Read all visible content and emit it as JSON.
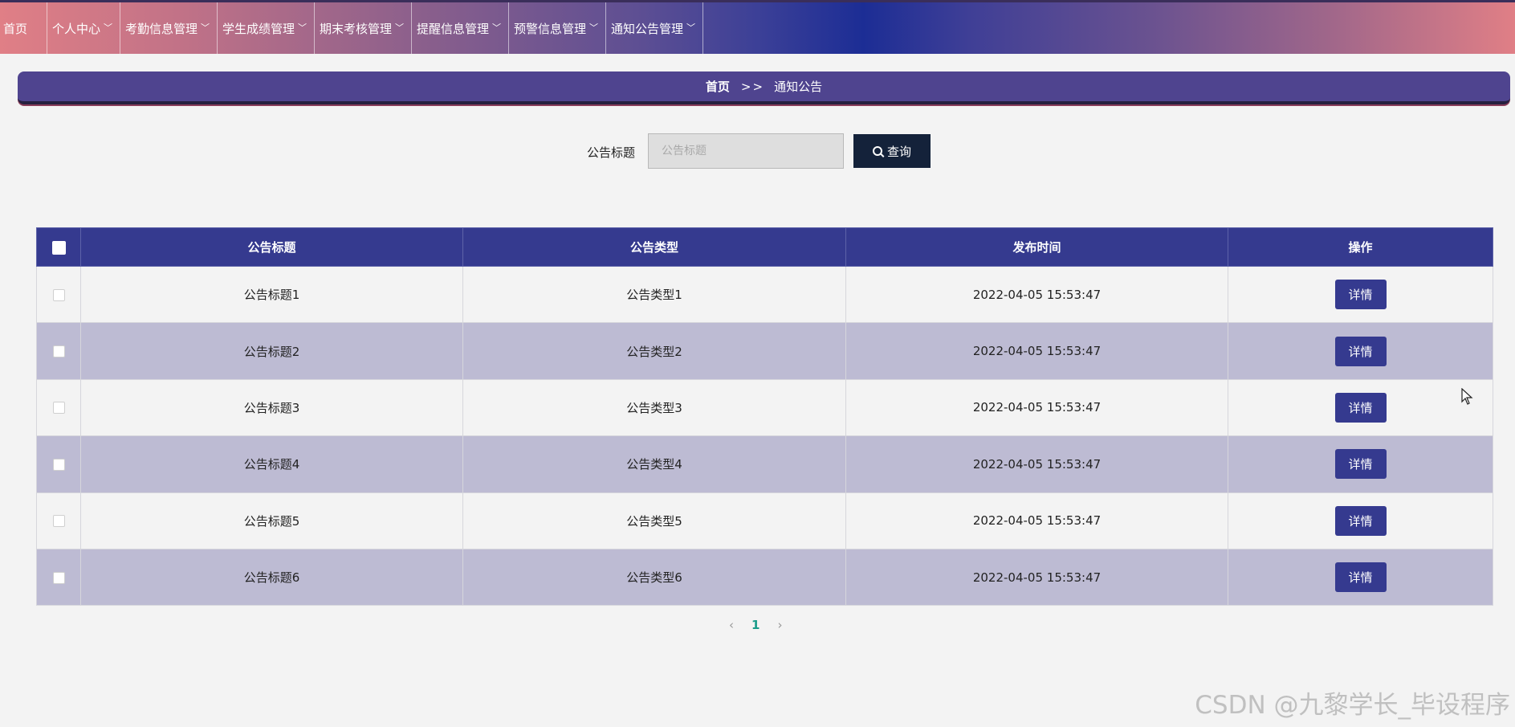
{
  "nav": {
    "home": "首页",
    "items": [
      {
        "label": "个人中心"
      },
      {
        "label": "考勤信息管理"
      },
      {
        "label": "学生成绩管理"
      },
      {
        "label": "期末考核管理"
      },
      {
        "label": "提醒信息管理"
      },
      {
        "label": "预警信息管理"
      },
      {
        "label": "通知公告管理"
      }
    ]
  },
  "breadcrumb": {
    "home": "首页",
    "separator": ">>",
    "current": "通知公告"
  },
  "search": {
    "label": "公告标题",
    "placeholder": "公告标题",
    "value": "",
    "button_label": "查询"
  },
  "table": {
    "columns": [
      "公告标题",
      "公告类型",
      "发布时间",
      "操作"
    ],
    "rows": [
      {
        "title": "公告标题1",
        "type": "公告类型1",
        "time": "2022-04-05 15:53:47",
        "action": "详情"
      },
      {
        "title": "公告标题2",
        "type": "公告类型2",
        "time": "2022-04-05 15:53:47",
        "action": "详情"
      },
      {
        "title": "公告标题3",
        "type": "公告类型3",
        "time": "2022-04-05 15:53:47",
        "action": "详情"
      },
      {
        "title": "公告标题4",
        "type": "公告类型4",
        "time": "2022-04-05 15:53:47",
        "action": "详情"
      },
      {
        "title": "公告标题5",
        "type": "公告类型5",
        "time": "2022-04-05 15:53:47",
        "action": "详情"
      },
      {
        "title": "公告标题6",
        "type": "公告类型6",
        "time": "2022-04-05 15:53:47",
        "action": "详情"
      }
    ]
  },
  "pagination": {
    "prev": "‹",
    "current_page": "1",
    "next": "›"
  },
  "watermark": "CSDN @九黎学长_毕设程序",
  "colors": {
    "primary": "#353a8f",
    "row_alt": "#bdbbd3",
    "search_button": "#14223a",
    "page_active": "#1a9c8a"
  },
  "icons": {
    "nav_dropdown": "chevron-down-icon",
    "search_button": "search-icon",
    "prev": "chevron-left-icon",
    "next": "chevron-right-icon"
  }
}
